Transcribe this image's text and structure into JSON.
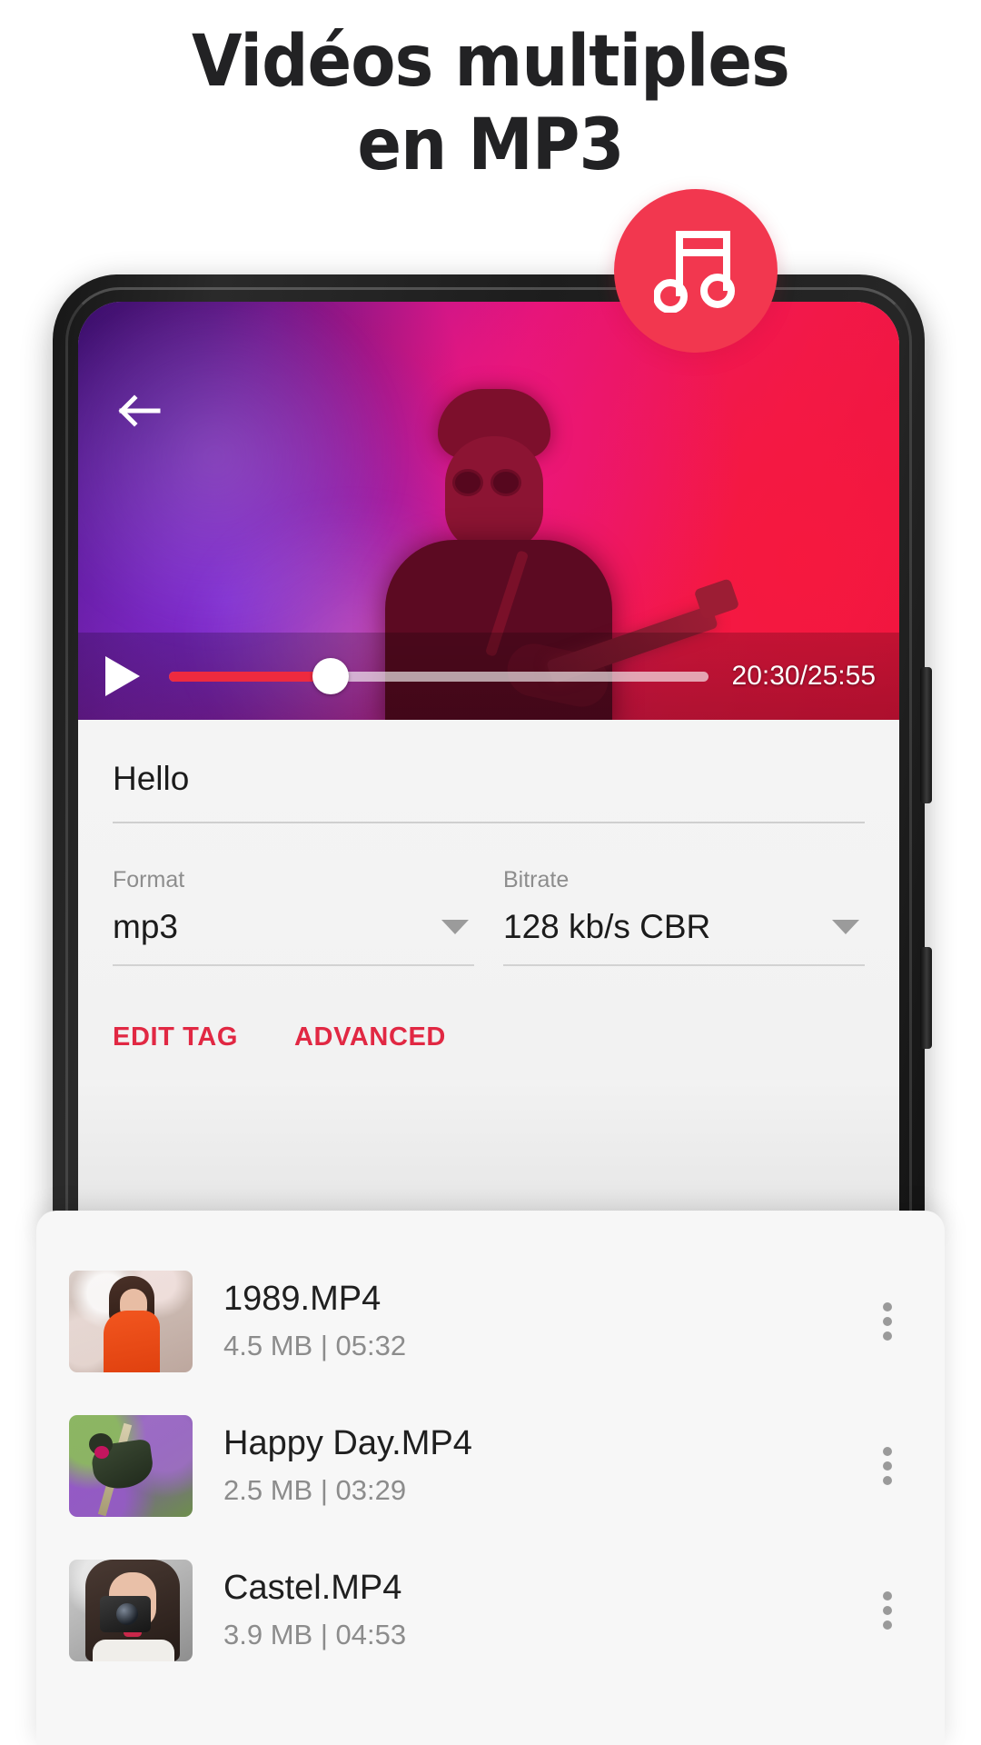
{
  "headline": {
    "line1": "Vidéos multiples",
    "line2": "en MP3"
  },
  "badge": {
    "icon": "music-note-icon",
    "color": "#f2374f"
  },
  "player": {
    "back_icon": "back-arrow-icon",
    "play_icon": "play-icon",
    "time": "20:30/25:55",
    "progress_percent": 30
  },
  "form": {
    "name_value": "Hello",
    "format": {
      "label": "Format",
      "value": "mp3"
    },
    "bitrate": {
      "label": "Bitrate",
      "value": "128 kb/s CBR"
    },
    "actions": {
      "edit_tag": "EDIT TAG",
      "advanced": "ADVANCED"
    },
    "accent_color": "#e12843"
  },
  "files": [
    {
      "name": "1989.MP4",
      "meta": "4.5 MB | 05:32"
    },
    {
      "name": "Happy Day.MP4",
      "meta": "2.5 MB | 03:29"
    },
    {
      "name": "Castel.MP4",
      "meta": "3.9 MB | 04:53"
    }
  ]
}
